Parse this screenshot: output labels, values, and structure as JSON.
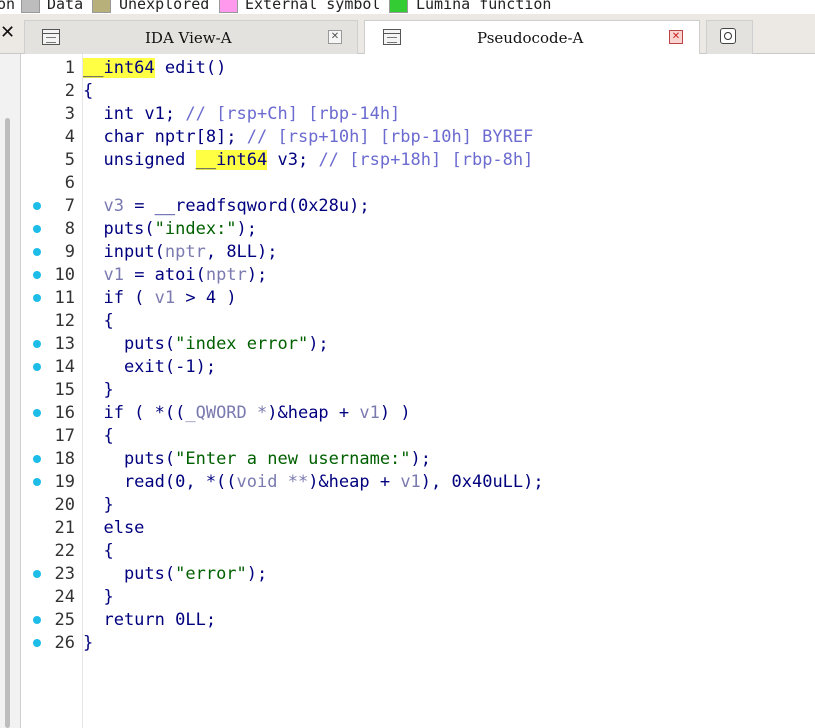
{
  "legend": [
    {
      "label": "on",
      "color": null
    },
    {
      "label": "Data",
      "color": "#bdbdbd"
    },
    {
      "label": "Unexplored",
      "color": "#b8b07a"
    },
    {
      "label": "External symbol",
      "color": "#ff99ee"
    },
    {
      "label": "Lumina function",
      "color": "#33cc33"
    }
  ],
  "tabs": {
    "left_close_glyph": "✕",
    "ida_view": {
      "label": "IDA View-A",
      "close": "✕"
    },
    "pseudocode": {
      "label": "Pseudocode-A",
      "close": "✕"
    }
  },
  "colors": {
    "keyword": "#00007f",
    "variable": "#7a7ab0",
    "string": "#006000",
    "comment": "#6b6bd0",
    "highlight": "#ffff44",
    "breakpoint_dot": "#1ebde8"
  },
  "code_lines": [
    {
      "num": "1",
      "bp": false,
      "tokens": [
        {
          "t": "__int64",
          "c": "hl"
        },
        {
          "t": " edit()",
          "c": ""
        }
      ]
    },
    {
      "num": "2",
      "bp": false,
      "tokens": [
        {
          "t": "{",
          "c": ""
        }
      ]
    },
    {
      "num": "3",
      "bp": false,
      "tokens": [
        {
          "t": "  int v1; ",
          "c": ""
        },
        {
          "t": "// [rsp+Ch] [rbp-14h]",
          "c": "com"
        }
      ]
    },
    {
      "num": "4",
      "bp": false,
      "tokens": [
        {
          "t": "  char nptr[8]; ",
          "c": ""
        },
        {
          "t": "// [rsp+10h] [rbp-10h] BYREF",
          "c": "com"
        }
      ]
    },
    {
      "num": "5",
      "bp": false,
      "tokens": [
        {
          "t": "  unsigned ",
          "c": ""
        },
        {
          "t": "__int64",
          "c": "hl"
        },
        {
          "t": " v3; ",
          "c": ""
        },
        {
          "t": "// [rsp+18h] [rbp-8h]",
          "c": "com"
        }
      ]
    },
    {
      "num": "6",
      "bp": false,
      "tokens": [
        {
          "t": "",
          "c": ""
        }
      ]
    },
    {
      "num": "7",
      "bp": true,
      "tokens": [
        {
          "t": "  ",
          "c": ""
        },
        {
          "t": "v3",
          "c": "var"
        },
        {
          "t": " = __readfsqword(0x28u);",
          "c": ""
        }
      ]
    },
    {
      "num": "8",
      "bp": true,
      "tokens": [
        {
          "t": "  puts(",
          "c": ""
        },
        {
          "t": "\"index:\"",
          "c": "str"
        },
        {
          "t": ");",
          "c": ""
        }
      ]
    },
    {
      "num": "9",
      "bp": true,
      "tokens": [
        {
          "t": "  input(",
          "c": ""
        },
        {
          "t": "nptr",
          "c": "var"
        },
        {
          "t": ", 8LL);",
          "c": ""
        }
      ]
    },
    {
      "num": "10",
      "bp": true,
      "tokens": [
        {
          "t": "  ",
          "c": ""
        },
        {
          "t": "v1",
          "c": "var"
        },
        {
          "t": " = atoi(",
          "c": ""
        },
        {
          "t": "nptr",
          "c": "var"
        },
        {
          "t": ");",
          "c": ""
        }
      ]
    },
    {
      "num": "11",
      "bp": true,
      "tokens": [
        {
          "t": "  if ( ",
          "c": ""
        },
        {
          "t": "v1",
          "c": "var"
        },
        {
          "t": " > 4 )",
          "c": ""
        }
      ]
    },
    {
      "num": "12",
      "bp": false,
      "tokens": [
        {
          "t": "  {",
          "c": ""
        }
      ]
    },
    {
      "num": "13",
      "bp": true,
      "tokens": [
        {
          "t": "    puts(",
          "c": ""
        },
        {
          "t": "\"index error\"",
          "c": "str"
        },
        {
          "t": ");",
          "c": ""
        }
      ]
    },
    {
      "num": "14",
      "bp": true,
      "tokens": [
        {
          "t": "    exit(-1);",
          "c": ""
        }
      ]
    },
    {
      "num": "15",
      "bp": false,
      "tokens": [
        {
          "t": "  }",
          "c": ""
        }
      ]
    },
    {
      "num": "16",
      "bp": true,
      "tokens": [
        {
          "t": "  if ( *((",
          "c": ""
        },
        {
          "t": "_QWORD *",
          "c": "var"
        },
        {
          "t": ")&heap + ",
          "c": ""
        },
        {
          "t": "v1",
          "c": "var"
        },
        {
          "t": ") )",
          "c": ""
        }
      ]
    },
    {
      "num": "17",
      "bp": false,
      "tokens": [
        {
          "t": "  {",
          "c": ""
        }
      ]
    },
    {
      "num": "18",
      "bp": true,
      "tokens": [
        {
          "t": "    puts(",
          "c": ""
        },
        {
          "t": "\"Enter a new username:\"",
          "c": "str"
        },
        {
          "t": ");",
          "c": ""
        }
      ]
    },
    {
      "num": "19",
      "bp": true,
      "tokens": [
        {
          "t": "    read(0, *((",
          "c": ""
        },
        {
          "t": "void **",
          "c": "var"
        },
        {
          "t": ")&heap + ",
          "c": ""
        },
        {
          "t": "v1",
          "c": "var"
        },
        {
          "t": "), 0x40uLL);",
          "c": ""
        }
      ]
    },
    {
      "num": "20",
      "bp": false,
      "tokens": [
        {
          "t": "  }",
          "c": ""
        }
      ]
    },
    {
      "num": "21",
      "bp": false,
      "tokens": [
        {
          "t": "  else",
          "c": ""
        }
      ]
    },
    {
      "num": "22",
      "bp": false,
      "tokens": [
        {
          "t": "  {",
          "c": ""
        }
      ]
    },
    {
      "num": "23",
      "bp": true,
      "tokens": [
        {
          "t": "    puts(",
          "c": ""
        },
        {
          "t": "\"error\"",
          "c": "str"
        },
        {
          "t": ");",
          "c": ""
        }
      ]
    },
    {
      "num": "24",
      "bp": false,
      "tokens": [
        {
          "t": "  }",
          "c": ""
        }
      ]
    },
    {
      "num": "25",
      "bp": true,
      "tokens": [
        {
          "t": "  return 0LL;",
          "c": ""
        }
      ]
    },
    {
      "num": "26",
      "bp": true,
      "tokens": [
        {
          "t": "}",
          "c": ""
        }
      ]
    }
  ]
}
